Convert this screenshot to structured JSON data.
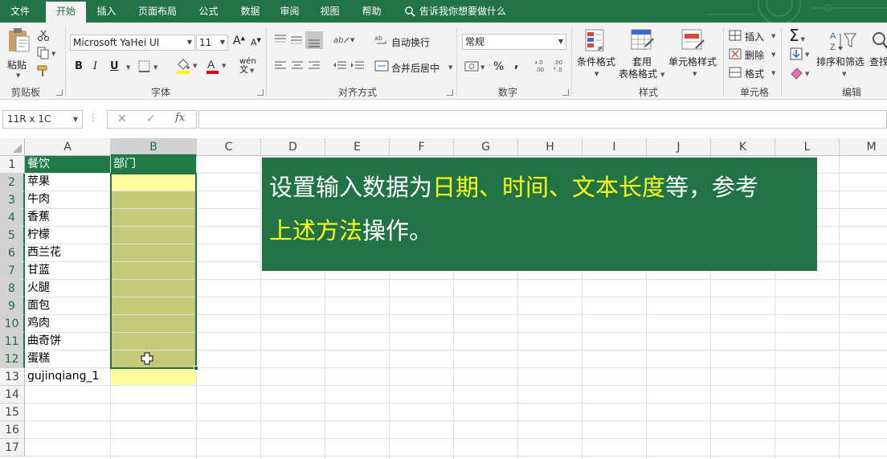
{
  "tabs": [
    {
      "label": "文件"
    },
    {
      "label": "开始"
    },
    {
      "label": "插入"
    },
    {
      "label": "页面布局"
    },
    {
      "label": "公式"
    },
    {
      "label": "数据"
    },
    {
      "label": "审阅"
    },
    {
      "label": "视图"
    },
    {
      "label": "帮助"
    }
  ],
  "tell_me": "告诉我你想要做什么",
  "ribbon": {
    "clipboard": {
      "paste": "粘贴",
      "label": "剪贴板"
    },
    "font": {
      "name": "Microsoft YaHei UI",
      "size": "11",
      "bold": "B",
      "italic": "I",
      "underline": "U",
      "font_color_glyph": "A",
      "grow": "A",
      "shrink": "A",
      "phonetic": "wén",
      "label": "字体"
    },
    "alignment": {
      "wrap": "自动换行",
      "merge": "合并后居中",
      "label": "对齐方式"
    },
    "number": {
      "format": "常规",
      "percent": "%",
      "comma": ",",
      "inc_decimal": "←.0\n.00",
      "dec_decimal": ".00\n→.0",
      "label": "数字"
    },
    "styles": {
      "conditional": "条件格式",
      "table_line1": "套用",
      "table_line2": "表格格式",
      "cell_styles": "单元格样式",
      "label": "样式"
    },
    "cells": {
      "insert": "插入",
      "delete": "删除",
      "format": "格式",
      "label": "单元格"
    },
    "editing": {
      "sort": "排序和筛选",
      "find": "查找",
      "label": "编辑"
    }
  },
  "formula_bar": {
    "name_box": "11R x 1C",
    "cancel": "✕",
    "enter": "✓",
    "fx": "fx",
    "value": ""
  },
  "columns": [
    "A",
    "B",
    "C",
    "D",
    "E",
    "F",
    "G",
    "H",
    "I",
    "J",
    "K",
    "L",
    "M"
  ],
  "rows": [
    "1",
    "2",
    "3",
    "4",
    "5",
    "6",
    "7",
    "8",
    "9",
    "10",
    "11",
    "12",
    "13",
    "14",
    "15",
    "16",
    "17"
  ],
  "cells": {
    "A": [
      "餐饮",
      "苹果",
      "牛肉",
      "香蕉",
      "柠檬",
      "西兰花",
      "甘蓝",
      "火腿",
      "面包",
      "鸡肉",
      "曲奇饼",
      "蛋糕",
      "gujinqiang_1"
    ],
    "B1": "部门"
  },
  "annotation": {
    "p1": "设置输入数据为",
    "h1": "日期、时间、文本长度",
    "p2": "等，参考",
    "h2": "上述方法",
    "p3": "操作。"
  },
  "colors": {
    "accent": "#217346",
    "highlight_text": "#ffff1a",
    "yellow_fill": "#ffff9d",
    "selected_fill": "#c9c97a"
  }
}
